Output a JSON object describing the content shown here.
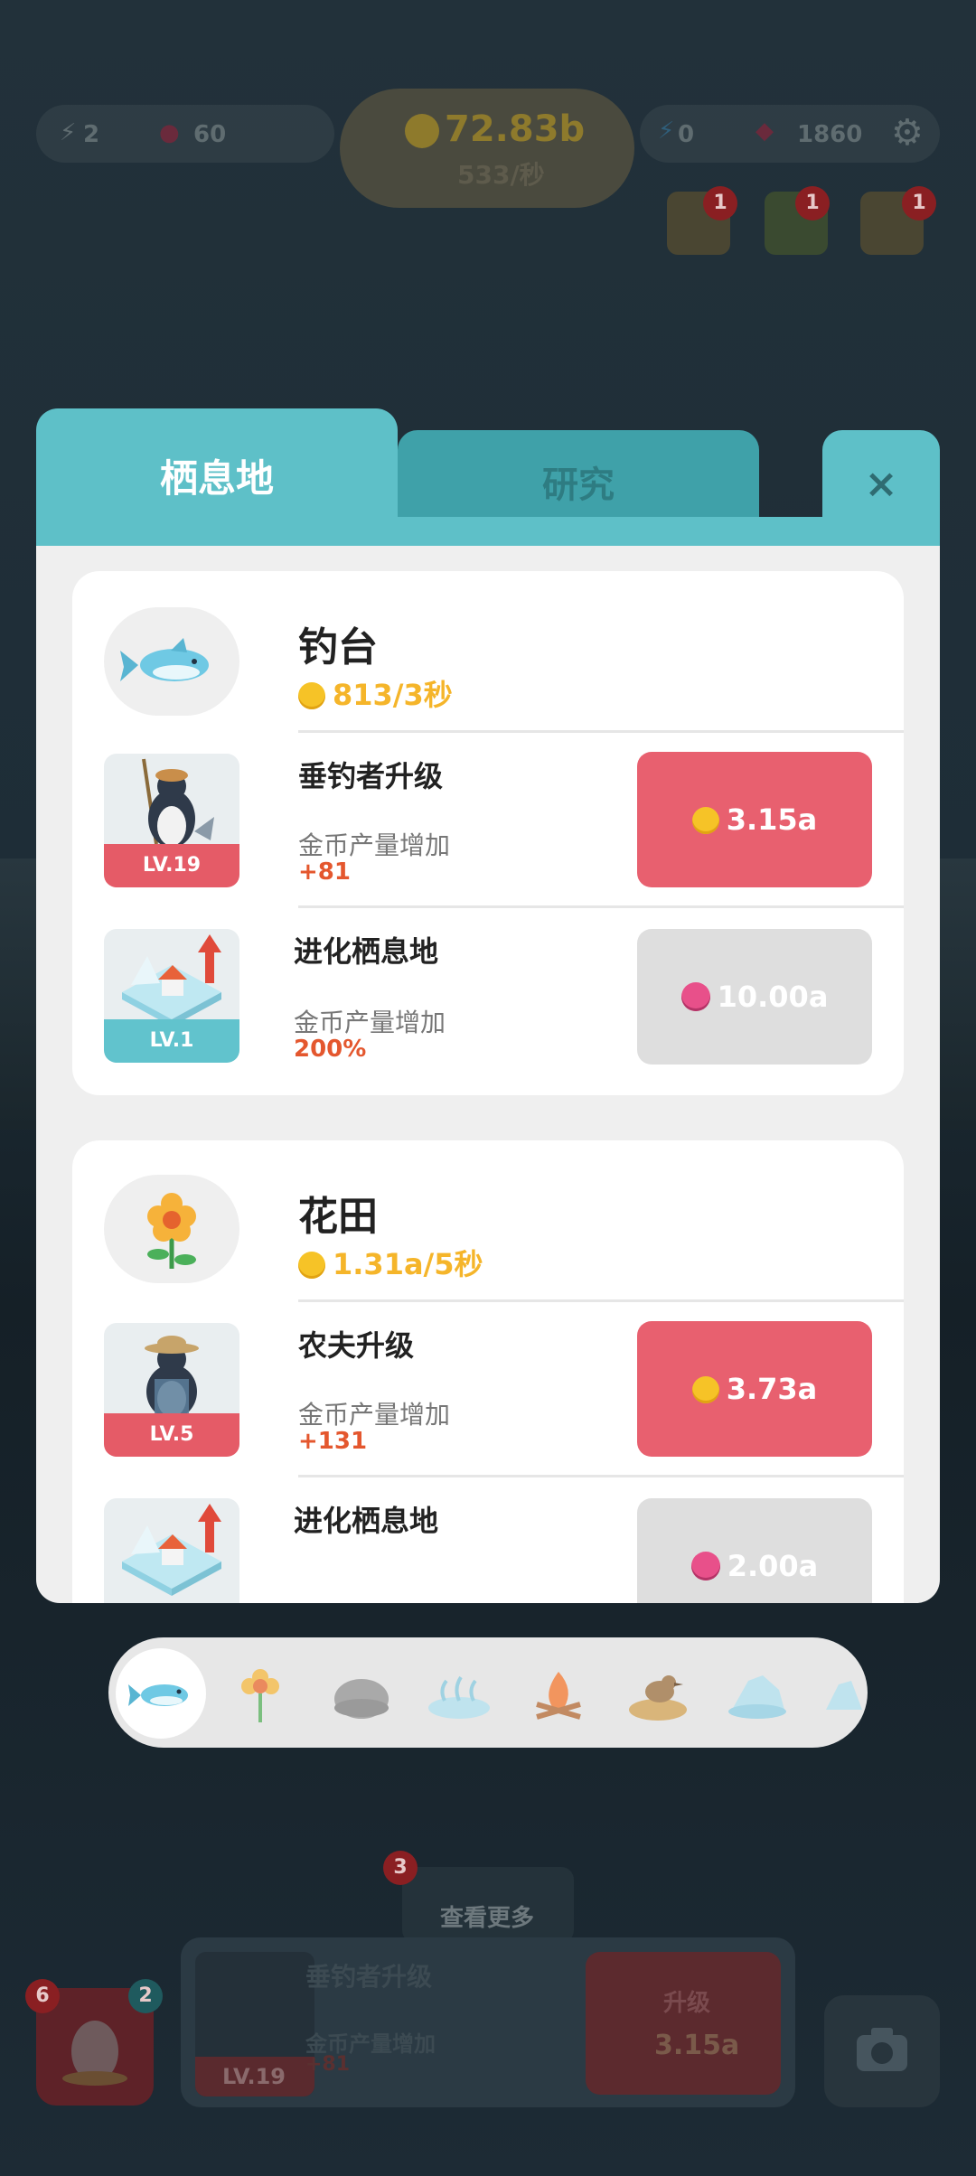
{
  "hud": {
    "bolt_count": "2",
    "heart_count": "60",
    "coins_total": "72.83b",
    "coins_rate": "533/秒",
    "energy_count": "0",
    "gems": "1860",
    "trophy_badge": "1",
    "calendar_badge": "1",
    "mail_badge": "1"
  },
  "tabs": {
    "habitat": "栖息地",
    "research": "研究",
    "close": "×"
  },
  "habitats": [
    {
      "title": "钓台",
      "rate": "813/3秒",
      "upgrades": [
        {
          "title": "垂钓者升级",
          "level": "LV.19",
          "desc": "金币产量增加",
          "value": "+81",
          "cost": "3.15a",
          "currency": "coin"
        },
        {
          "title": "进化栖息地",
          "level": "LV.1",
          "desc": "金币产量增加",
          "value": "200%",
          "cost": "10.00a",
          "currency": "gem"
        }
      ]
    },
    {
      "title": "花田",
      "rate": "1.31a/5秒",
      "upgrades": [
        {
          "title": "农夫升级",
          "level": "LV.5",
          "desc": "金币产量增加",
          "value": "+131",
          "cost": "3.73a",
          "currency": "coin"
        },
        {
          "title": "进化栖息地",
          "cost": "2.00a",
          "currency": "gem"
        }
      ]
    }
  ],
  "bottom": {
    "more_badge": "3",
    "more_label": "查看更多",
    "egg_badge_red": "6",
    "egg_badge_teal": "2",
    "upgrade_title": "垂钓者升级",
    "upgrade_desc": "金币产量增加",
    "upgrade_value": "+81",
    "upgrade_level": "LV.19",
    "upgrade_button": "升级",
    "upgrade_cost": "3.15a"
  },
  "colors": {
    "teal": "#5ec0c8",
    "red_button": "#e8606f",
    "gold": "#f5b52a",
    "orange_value": "#e4572e"
  }
}
